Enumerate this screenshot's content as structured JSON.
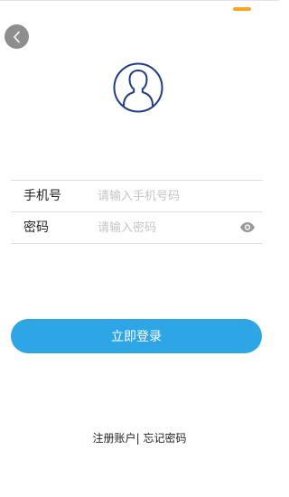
{
  "colors": {
    "accent": "#2ea6e6",
    "status_indicator": "#f5a623",
    "avatar_outline": "#1f3c88"
  },
  "header": {
    "back_icon": "chevron-left-icon"
  },
  "avatar": {
    "icon": "user-avatar-icon"
  },
  "form": {
    "phone": {
      "label": "手机号",
      "placeholder": "请输入手机号码",
      "value": ""
    },
    "password": {
      "label": "密码",
      "placeholder": "请输入密码",
      "value": "",
      "toggle_icon": "eye-icon"
    }
  },
  "login_button": {
    "label": "立即登录"
  },
  "footer": {
    "register_label": "注册账户",
    "separator": "|",
    "forgot_label": "忘记密码"
  }
}
